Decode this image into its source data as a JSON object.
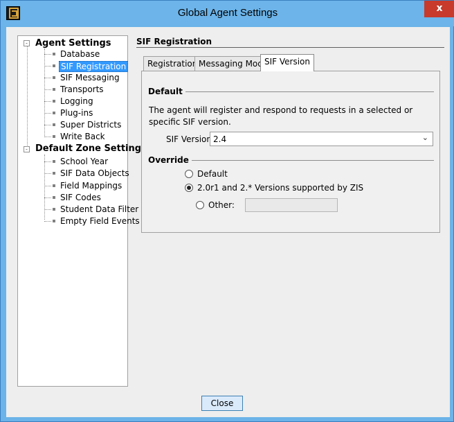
{
  "window": {
    "title": "Global Agent Settings",
    "close_glyph": "x"
  },
  "tree": {
    "groups": [
      {
        "label": "Agent Settings",
        "expander": "-",
        "items": [
          "Database",
          "SIF Registration",
          "SIF Messaging",
          "Transports",
          "Logging",
          "Plug-ins",
          "Super Districts",
          "Write Back"
        ]
      },
      {
        "label": "Default Zone Settings",
        "expander": "-",
        "items": [
          "School Year",
          "SIF Data Objects",
          "Field Mappings",
          "SIF Codes",
          "Student Data Filter",
          "Empty Field Events"
        ]
      }
    ],
    "selected": "SIF Registration"
  },
  "section": {
    "title": "SIF Registration"
  },
  "tabs": [
    {
      "label": "Registration",
      "active": false
    },
    {
      "label": "Messaging Mode",
      "active": false
    },
    {
      "label": "SIF Version",
      "active": true
    }
  ],
  "default_group": {
    "title": "Default",
    "description": "The agent will register and respond to requests in a selected or specific SIF version.",
    "version_label": "SIF Version",
    "version_value": "2.4",
    "chevron": "⌄"
  },
  "override_group": {
    "title": "Override",
    "options": [
      {
        "label": "Default",
        "checked": false
      },
      {
        "label": "2.0r1 and 2.* Versions supported by ZIS",
        "checked": true
      },
      {
        "label": "Other:",
        "checked": false
      }
    ],
    "other_value": ""
  },
  "footer": {
    "close_label": "Close"
  },
  "colors": {
    "title_bar": "#6cb4e9",
    "close_button": "#c73a2c",
    "selection": "#3399ff"
  }
}
